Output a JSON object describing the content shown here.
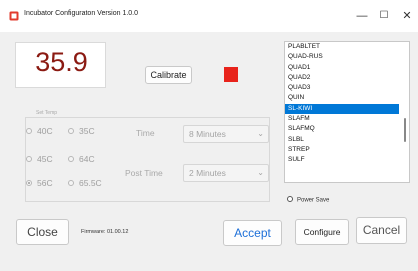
{
  "window": {
    "title": "Incubator Configuraton Version 1.0.0",
    "controls": {
      "minimize": "—",
      "maximize": "☐",
      "close": "✕"
    }
  },
  "temperature": {
    "value": "35.9",
    "color": "#8b1a12"
  },
  "calibrate": {
    "label": "Calibrate",
    "indicator_color": "#e8231b"
  },
  "set_temp": {
    "label": "Set Temp",
    "options": [
      "40C",
      "35C",
      "45C",
      "64C",
      "56C",
      "65.5C"
    ],
    "selected": "56C"
  },
  "time": {
    "label": "Time",
    "value": "8 Minutes"
  },
  "post_time": {
    "label": "Post Time",
    "value": "2 Minutes"
  },
  "profiles": {
    "items": [
      "PLABLTET",
      "QUAD-RUS",
      "QUAD1",
      "QUAD2",
      "QUAD3",
      "QUIN",
      "SL-KIWI",
      "SLAFM",
      "SLAFMQ",
      "SLBL",
      "STREP",
      "SULF"
    ],
    "selected": "SL-KIWI"
  },
  "power_save": {
    "label": "Power Save",
    "checked": false
  },
  "firmware": {
    "text": "Firmware: 01.00.12"
  },
  "buttons": {
    "close": "Close",
    "accept": "Accept",
    "configure": "Configure",
    "cancel": "Cancel"
  },
  "colors": {
    "accent": "#0078d7",
    "accept_text": "#1d6fd8"
  }
}
